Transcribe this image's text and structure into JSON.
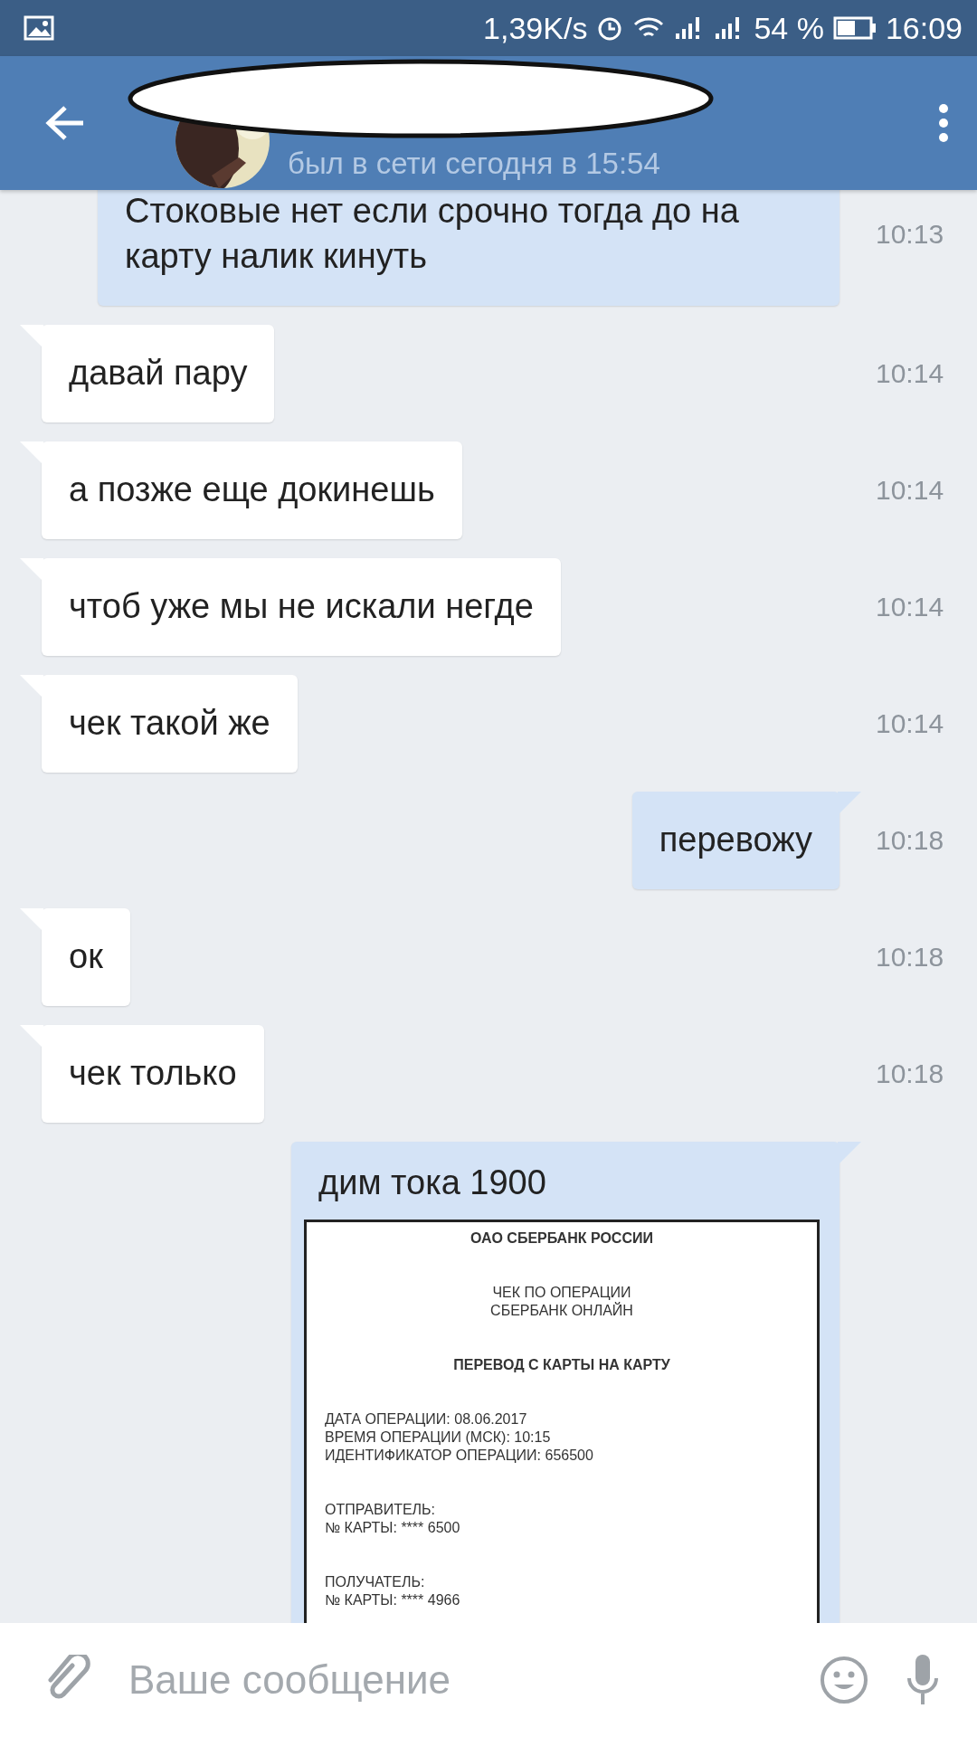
{
  "status_bar": {
    "speed": "1,39K/s",
    "battery": "54 %",
    "time": "16:09"
  },
  "header": {
    "status": "был в сети сегодня в 15:54"
  },
  "messages": [
    {
      "kind": "text",
      "outgoing": true,
      "text": "Стоковые нет если срочно тогда до на карту налик кинуть",
      "time": "10:13"
    },
    {
      "kind": "text",
      "outgoing": false,
      "text": "давай пару",
      "time": "10:14"
    },
    {
      "kind": "text",
      "outgoing": false,
      "text": "а позже еще докинешь",
      "time": "10:14"
    },
    {
      "kind": "text",
      "outgoing": false,
      "text": "чтоб уже мы не искали негде",
      "time": "10:14"
    },
    {
      "kind": "text",
      "outgoing": false,
      "text": "чек такой же",
      "time": "10:14"
    },
    {
      "kind": "text",
      "outgoing": true,
      "text": "перевожу",
      "time": "10:18"
    },
    {
      "kind": "text",
      "outgoing": false,
      "text": "ок",
      "time": "10:18"
    },
    {
      "kind": "text",
      "outgoing": false,
      "text": "чек только",
      "time": "10:18"
    },
    {
      "kind": "receipt",
      "outgoing": true,
      "text": "дим тока 1900",
      "receipt": {
        "bank": "ОАО СБЕРБАНК РОССИИ",
        "subtitle": [
          "ЧЕК ПО ОПЕРАЦИИ",
          "СБЕРБАНК ОНЛАЙН"
        ],
        "operation": "ПЕРЕВОД С КАРТЫ НА КАРТУ",
        "groups": [
          [
            "ДАТА ОПЕРАЦИИ:  08.06.2017",
            "ВРЕМЯ ОПЕРАЦИИ (МСК): 10:15",
            "ИДЕНТИФИКАТОР ОПЕРАЦИИ: 656500"
          ],
          [
            "ОТПРАВИТЕЛЬ:",
            "№ КАРТЫ: **** 6500"
          ],
          [
            "ПОЛУЧАТЕЛЬ:",
            "№ КАРТЫ: **** 4966"
          ]
        ]
      }
    }
  ],
  "composer": {
    "placeholder": "Ваше сообщение"
  }
}
